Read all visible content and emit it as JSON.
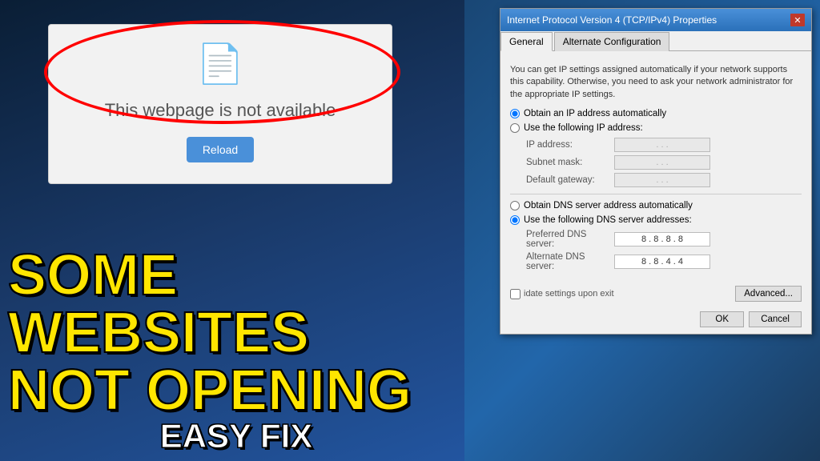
{
  "background": {
    "color_left": "#0a1e35",
    "color_right": "#2266aa"
  },
  "browser_error": {
    "error_message": "This webpage is not available",
    "reload_button": "Reload"
  },
  "overlay_text": {
    "line1": "SOME",
    "line2": "WEBSITES",
    "line3": "NOT OPENING",
    "line4": "EASY FIX"
  },
  "dialog": {
    "title": "Internet Protocol Version 4 (TCP/IPv4) Properties",
    "close_button": "✕",
    "tabs": [
      {
        "label": "General",
        "active": true
      },
      {
        "label": "Alternate Configuration",
        "active": false
      }
    ],
    "info_text": "You can get IP settings assigned automatically if your network supports this capability. Otherwise, you need to ask your network administrator for the appropriate IP settings.",
    "obtain_ip_auto": "Obtain an IP address automatically",
    "use_following_ip": "Use the following IP address:",
    "ip_address_label": "IP address:",
    "ip_address_value": ". . .",
    "subnet_mask_label": "Subnet mask:",
    "subnet_mask_value": ". . .",
    "default_gateway_label": "Default gateway:",
    "default_gateway_value": ". . .",
    "obtain_dns_auto": "Obtain DNS server address automatically",
    "use_following_dns": "Use the following DNS server addresses:",
    "preferred_dns_label": "Preferred DNS server:",
    "preferred_dns_value": "8 . 8 . 8 . 8",
    "alternate_dns_label": "Alternate DNS server:",
    "alternate_dns_value": "8 . 8 . 4 . 4",
    "validate_text": "idate settings upon exit",
    "advanced_button": "Advanced...",
    "ok_button": "OK",
    "cancel_button": "Cancel"
  }
}
